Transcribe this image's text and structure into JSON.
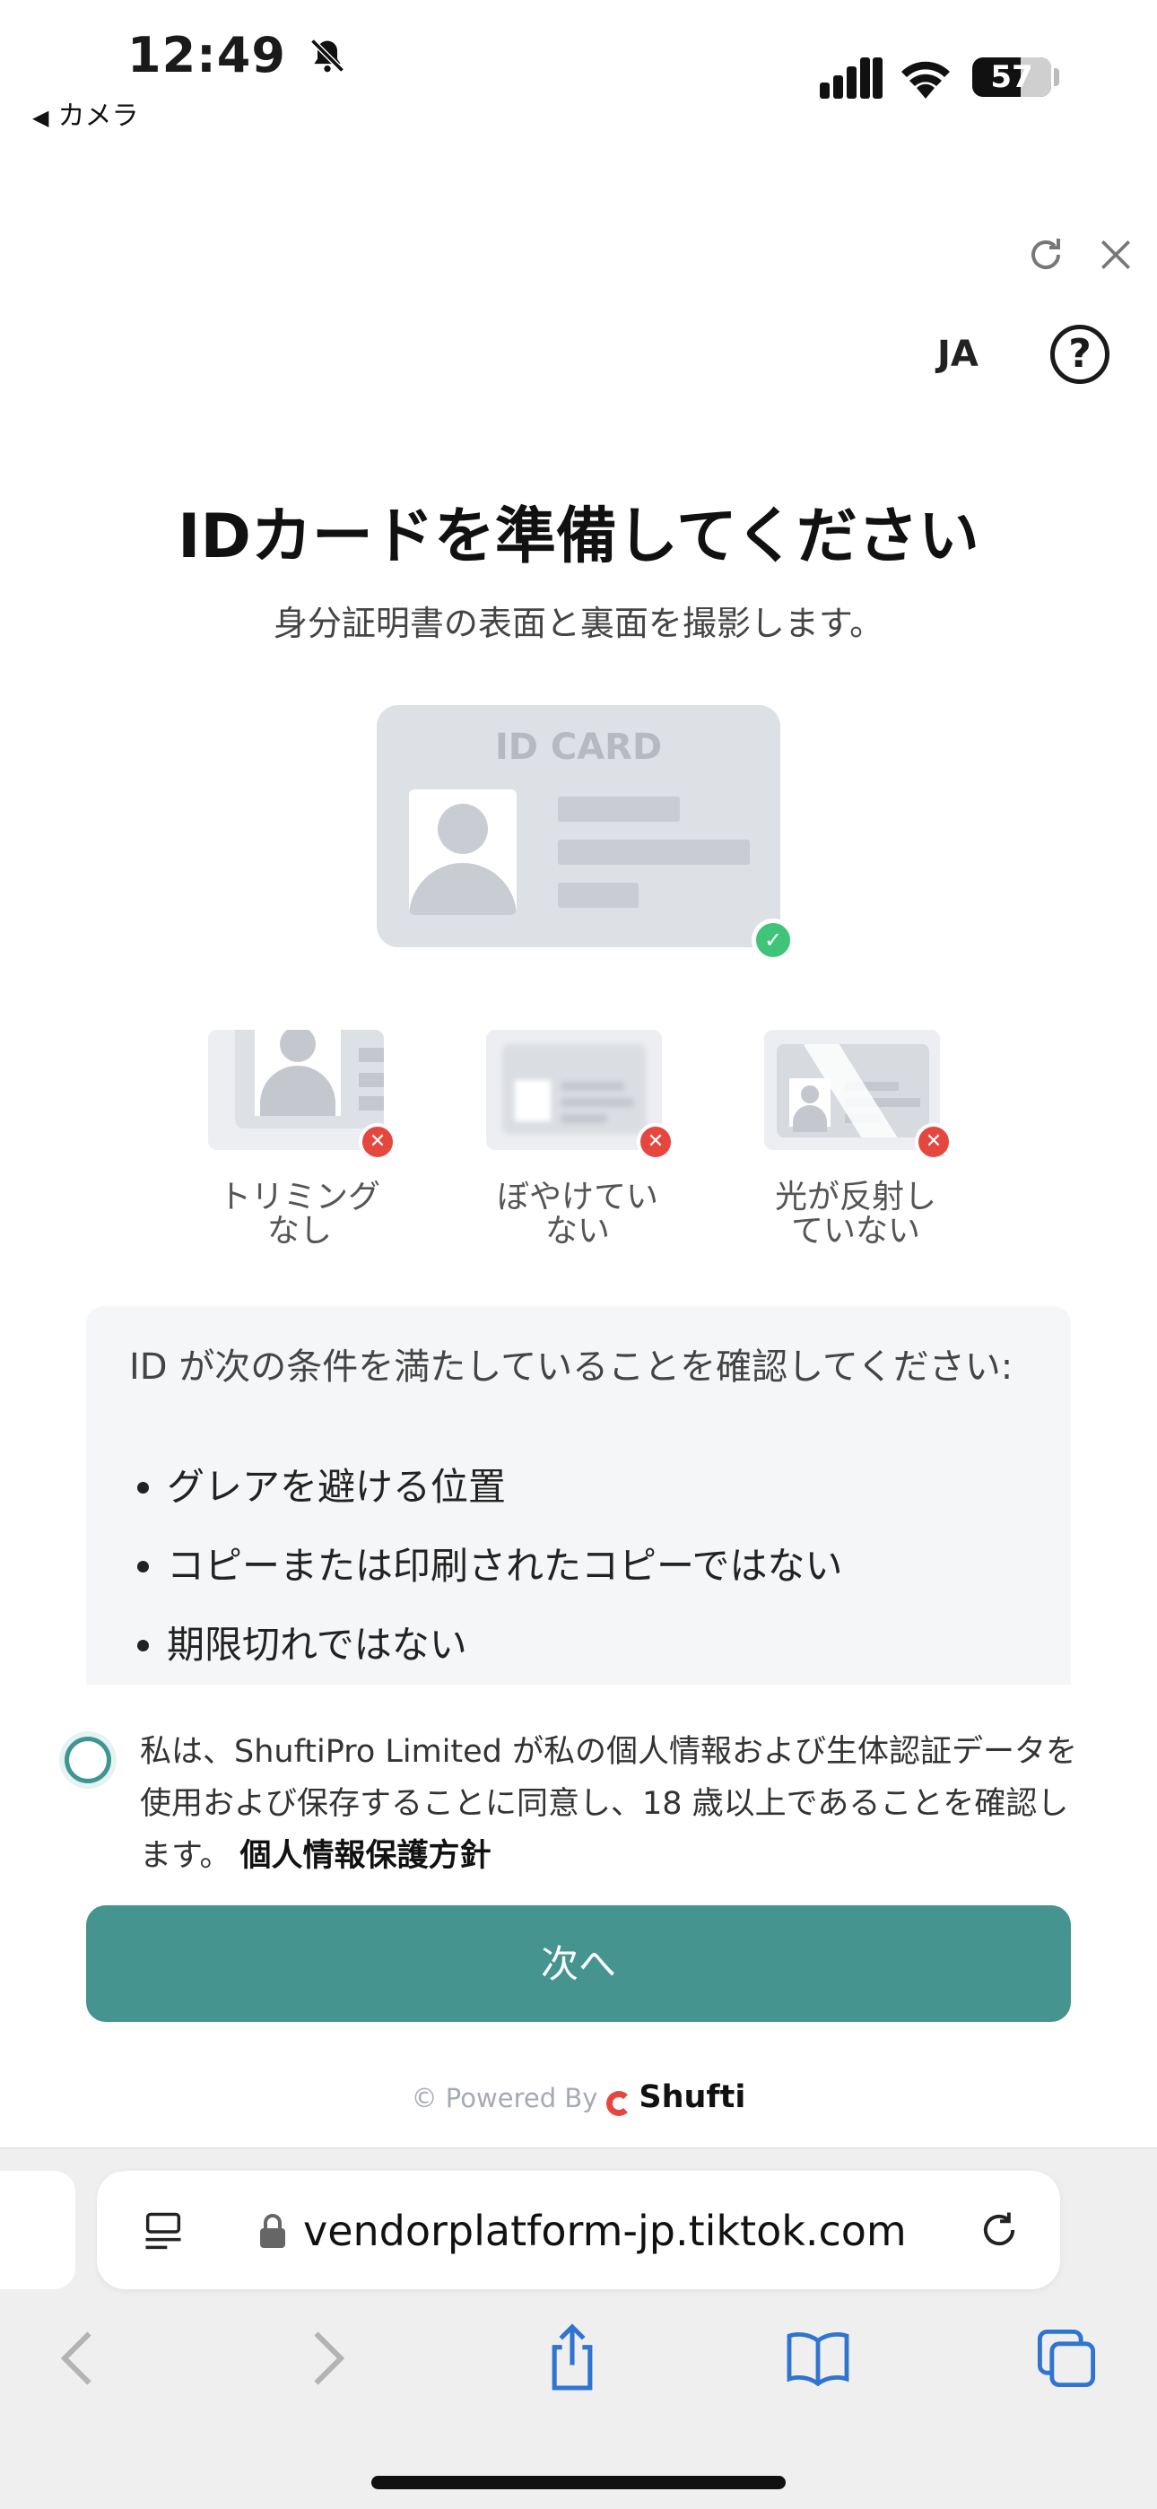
{
  "status_bar": {
    "time": "12:49",
    "battery": "57",
    "back_app": "カメラ"
  },
  "header": {
    "language": "JA",
    "help_symbol": "?"
  },
  "title": "IDカードを準備してください",
  "subtitle": "身分証明書の表面と裏面を撮影します。",
  "id_card_caption": "ID CARD",
  "examples": [
    {
      "label_line1": "トリミング",
      "label_line2": "なし"
    },
    {
      "label_line1": "ぼやけてい",
      "label_line2": "ない"
    },
    {
      "label_line1": "光が反射し",
      "label_line2": "ていない"
    }
  ],
  "conditions": {
    "heading": "ID が次の条件を満たしていることを確認してください:",
    "items": [
      "グレアを避ける位置",
      "コピーまたは印刷されたコピーではない",
      "期限切れではない"
    ]
  },
  "consent": {
    "text": "私は、ShuftiPro Limited が私の個人情報および生体認証データを使用および保存することに同意し、18 歳以上であることを確認します。",
    "link": "個人情報保護方針"
  },
  "next_button": "次へ",
  "footer": {
    "powered_by": "© Powered By",
    "brand": "Shufti"
  },
  "browser": {
    "url": "vendorplatform-jp.tiktok.com"
  },
  "colors": {
    "accent": "#45948f",
    "error": "#e5473e",
    "success": "#3fc47a"
  }
}
